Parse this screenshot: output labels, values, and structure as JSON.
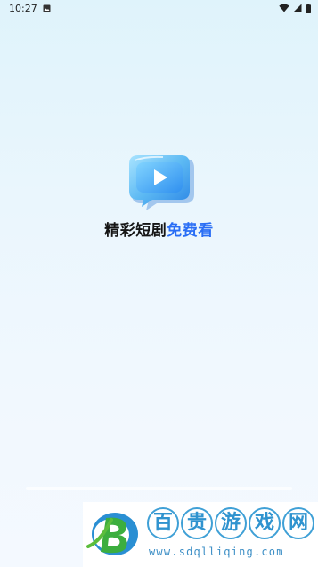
{
  "status_bar": {
    "time": "10:27",
    "notification_icon": "photo-notification-icon",
    "wifi_icon": "wifi-icon",
    "signal_icon": "signal-icon",
    "battery_icon": "battery-icon"
  },
  "splash": {
    "logo_icon": "video-play-chat-bubble-icon",
    "slogan_part1": "精彩短剧",
    "slogan_part2": "免费看",
    "slogan_part1_color": "#151515",
    "slogan_part2_color": "#2a6ef5"
  },
  "watermark": {
    "logo_icon": "letter-b-logo-icon",
    "chars": [
      "百",
      "贵",
      "游",
      "戏",
      "网"
    ],
    "url": "www.sdqlliqing.com",
    "color": "#3fa0d6"
  }
}
